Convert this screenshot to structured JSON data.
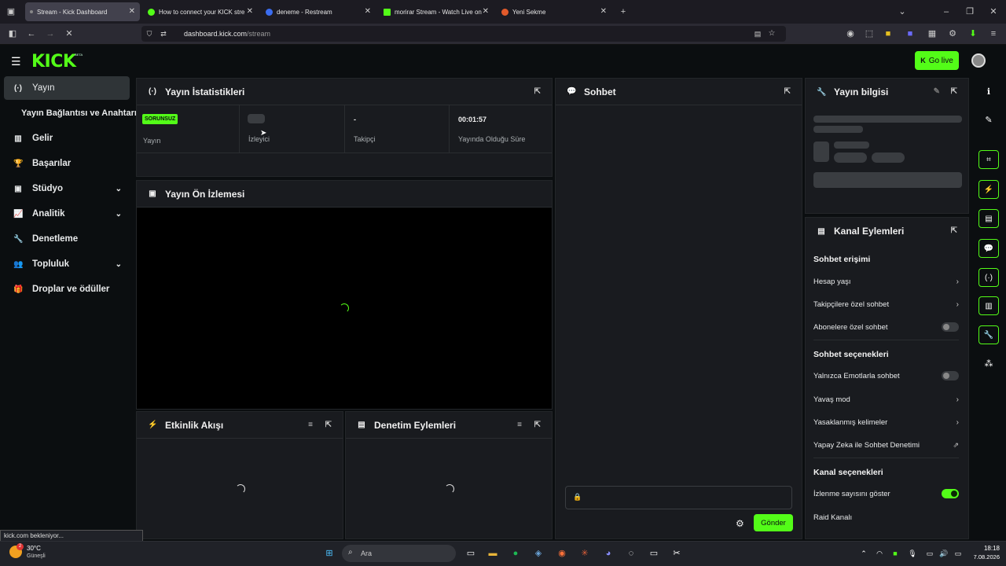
{
  "browser": {
    "tabs": [
      {
        "title": "Stream - Kick Dashboard",
        "active": true
      },
      {
        "title": "How to connect your KICK stre"
      },
      {
        "title": "deneme - Restream"
      },
      {
        "title": "morirar Stream - Watch Live on"
      },
      {
        "title": "Yeni Sekme"
      }
    ],
    "url_host": "dashboard.kick.com",
    "url_path": "/stream",
    "status_text": "kick.com bekleniyor..."
  },
  "header": {
    "logo": "KICK",
    "logo_badge": "BETA",
    "go_live": "Go live"
  },
  "sidebar": {
    "items": [
      {
        "label": "Yayın",
        "icon": "broadcast-icon"
      },
      {
        "label": "Yayın Bağlantısı ve Anahtarı"
      },
      {
        "label": "Gelir",
        "icon": "chart-icon"
      },
      {
        "label": "Başarılar",
        "icon": "trophy-icon"
      },
      {
        "label": "Stüdyo",
        "icon": "studio-icon"
      },
      {
        "label": "Analitik",
        "icon": "analytics-icon"
      },
      {
        "label": "Denetleme",
        "icon": "wrench-icon"
      },
      {
        "label": "Topluluk",
        "icon": "community-icon"
      },
      {
        "label": "Droplar ve ödüller",
        "icon": "gift-icon"
      }
    ]
  },
  "stats_panel": {
    "title": "Yayın İstatistikleri",
    "status_badge": "SORUNSUZ",
    "labels": [
      "Yayın",
      "İzleyici",
      "Takipçi",
      "Yayında Olduğu Süre"
    ],
    "follower_value": "-",
    "uptime_value": "00:01:57"
  },
  "preview_panel": {
    "title": "Yayın Ön İzlemesi"
  },
  "activity_panel": {
    "title": "Etkinlik Akışı"
  },
  "moderation_panel": {
    "title": "Denetim Eylemleri"
  },
  "chat_panel": {
    "title": "Sohbet",
    "send": "Gönder"
  },
  "stream_info": {
    "title": "Yayın bilgisi"
  },
  "channel_actions": {
    "title": "Kanal Eylemleri",
    "sec_chat_access": "Sohbet erişimi",
    "account_age": "Hesap yaşı",
    "followers_only": "Takipçilere özel sohbet",
    "subs_only": "Abonelere özel sohbet",
    "sec_chat_options": "Sohbet seçenekleri",
    "emote_only": "Yalnızca Emotlarla sohbet",
    "slow_mode": "Yavaş mod",
    "banned_words": "Yasaklanmış kelimeler",
    "ai_moderation": "Yapay Zeka ile Sohbet Denetimi",
    "sec_channel_options": "Kanal seçenekleri",
    "show_viewers": "İzlenme sayısını göster",
    "raid": "Raid Kanalı",
    "show_viewers_on": true
  },
  "taskbar": {
    "weather_temp": "30°C",
    "weather_desc": "Güneşli",
    "weather_badge": "2",
    "search": "Ara",
    "time": "18:18",
    "date": "7.08.2026"
  },
  "colors": {
    "accent": "#53fc18",
    "bg": "#0b0e10",
    "panel": "#191b1f"
  }
}
